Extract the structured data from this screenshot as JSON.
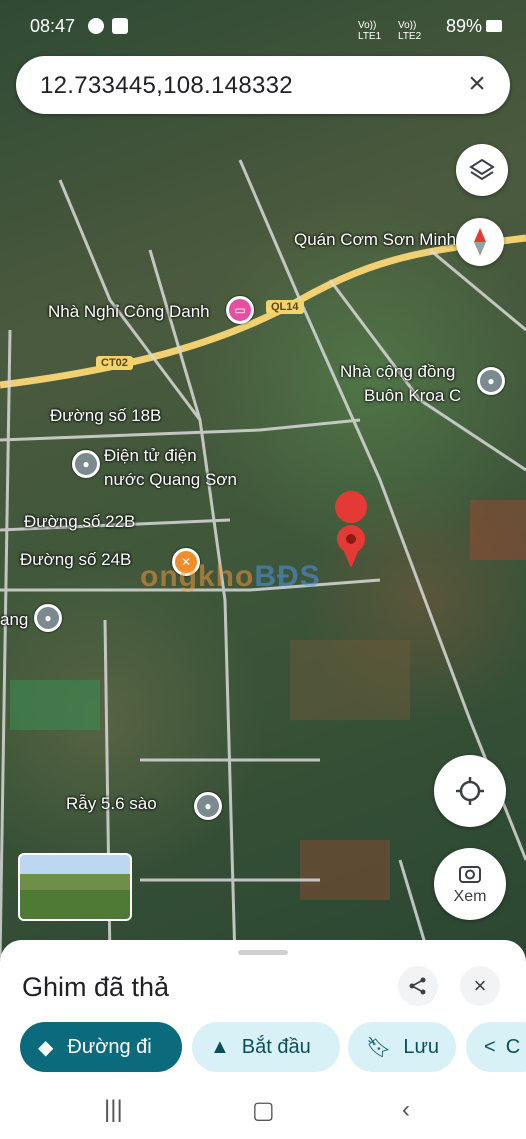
{
  "status_bar": {
    "time": "08:47",
    "battery": "89%",
    "sim1": "Vo)) LTE1",
    "sim2": "Vo)) LTE2"
  },
  "search": {
    "query": "12.733445,108.148332"
  },
  "map": {
    "roads": {
      "ct02": "CT02",
      "ql14": "QL14"
    },
    "places": {
      "quan_com": "Quán Cơm Sơn Minh",
      "nha_nghi": "Nhà Nghỉ Công Danh",
      "nha_cong_dong_1": "Nhà cộng đồng",
      "nha_cong_dong_2": "Buôn Kroa C",
      "duong_18b": "Đường số 18B",
      "dien_tu_1": "Điện tử điện",
      "dien_tu_2": "nước Quang Sơn",
      "duong_22b": "Đường số 22B",
      "duong_24b": "Đường số 24B",
      "ang": "ang",
      "ray": "Rẫy 5.6 sào"
    },
    "watermark_a": "ongkho",
    "watermark_b": "BĐS"
  },
  "controls": {
    "xem_label": "Xem"
  },
  "sheet": {
    "title": "Ghim đã thả",
    "directions": "Đường đi",
    "start": "Bắt đầu",
    "save": "Lưu",
    "share_partial": "C"
  }
}
